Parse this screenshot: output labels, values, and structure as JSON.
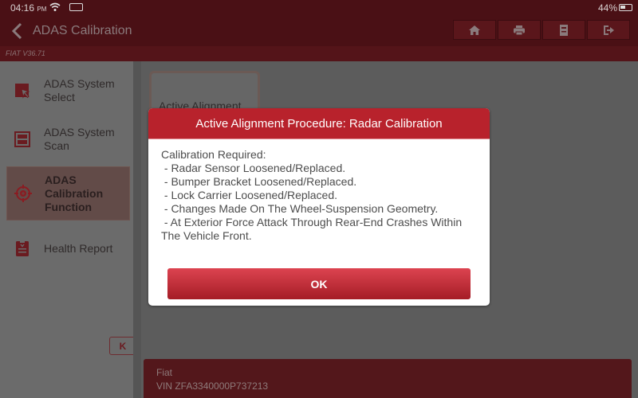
{
  "status_bar": {
    "time": "04:16",
    "time_suffix": "PM",
    "wifi_icon": "wifi-icon",
    "vci_icon": "vci-connector-icon",
    "battery_percent": "44%",
    "battery_level": 0.44
  },
  "header": {
    "title": "ADAS Calibration",
    "back_icon": "chevron-left-icon",
    "toolbar": [
      {
        "name": "home",
        "icon": "home-icon"
      },
      {
        "name": "print",
        "icon": "printer-icon"
      },
      {
        "name": "adas-report",
        "icon": "adas-document-icon"
      },
      {
        "name": "exit",
        "icon": "exit-icon"
      }
    ]
  },
  "version": "FIAT V36.71",
  "sidebar": {
    "items": [
      {
        "label_line1": "ADAS System",
        "label_line2": "Select",
        "icon": "select-cursor-icon",
        "active": false
      },
      {
        "label_line1": "ADAS System",
        "label_line2": "Scan",
        "icon": "scan-icon",
        "active": false
      },
      {
        "label_line1": "ADAS",
        "label_line2": "Calibration",
        "label_line3": "Function",
        "icon": "target-icon",
        "active": true
      },
      {
        "label_line1": "Health Report",
        "icon": "clipboard-health-icon",
        "active": false
      }
    ],
    "collapse_label": "K"
  },
  "main": {
    "cards": [
      {
        "label": "Active Alignment"
      }
    ]
  },
  "vehicle": {
    "make": "Fiat",
    "vin": "VIN ZFA3340000P737213"
  },
  "dialog": {
    "title": "Active Alignment Procedure: Radar Calibration",
    "lines": [
      "Calibration Required:",
      " - Radar Sensor Loosened/Replaced.",
      " - Bumper Bracket Loosened/Replaced.",
      " - Lock Carrier Loosened/Replaced.",
      " - Changes Made On The Wheel-Suspension Geometry.",
      " - At Exterior Force Attack Through Rear-End Crashes Within",
      "The Vehicle Front."
    ],
    "ok_label": "OK"
  },
  "colors": {
    "brand_red": "#b8222c",
    "header_dark": "#4a1015",
    "overlay_gray": "#5c5c5c"
  }
}
